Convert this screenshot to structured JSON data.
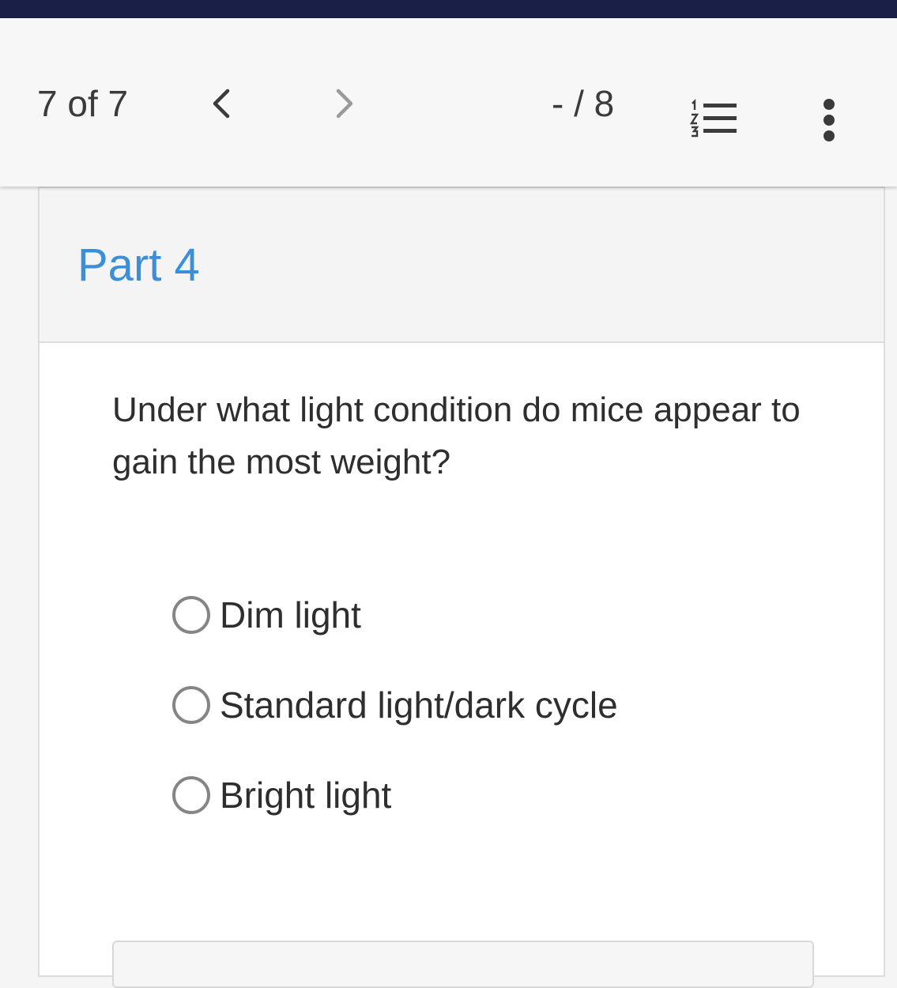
{
  "header": {
    "counter": "7 of 7",
    "prev_icon": "chevron-left-icon",
    "next_icon": "chevron-right-icon",
    "score": "- / 8",
    "list_icon": "numbered-list-icon",
    "more_icon": "more-vertical-icon",
    "topbar_color": "#1a1f47"
  },
  "card": {
    "part_title": "Part 4",
    "part_title_color": "#3a8fd8",
    "question": "Under what light condition do mice appear to gain the most weight?",
    "options": [
      {
        "label": "Dim light",
        "selected": false
      },
      {
        "label": "Standard light/dark cycle",
        "selected": false
      },
      {
        "label": "Bright light",
        "selected": false
      }
    ]
  }
}
